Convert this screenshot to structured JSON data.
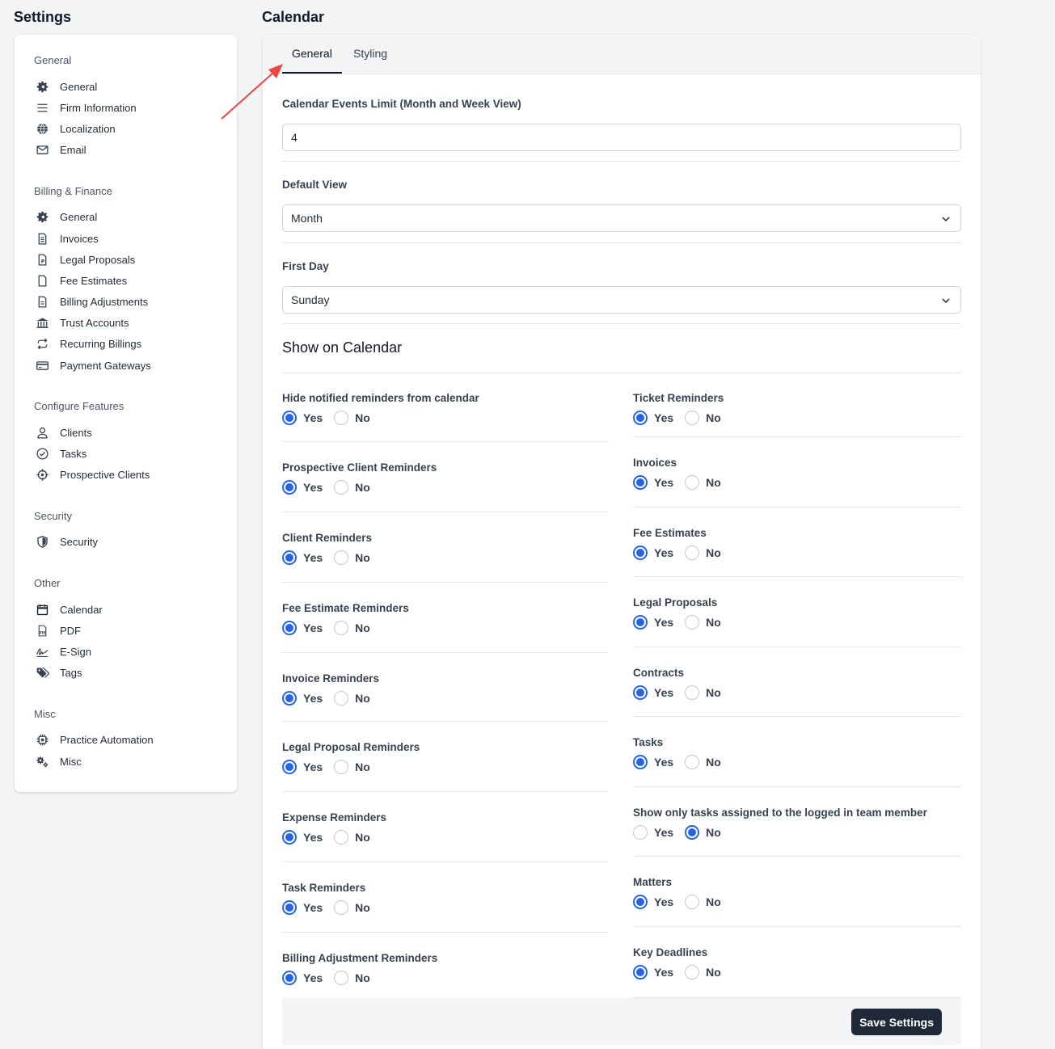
{
  "sidebar": {
    "title": "Settings",
    "groups": [
      {
        "title": "General",
        "items": [
          {
            "label": "General",
            "icon": "gear-icon"
          },
          {
            "label": "Firm Information",
            "icon": "lines-icon"
          },
          {
            "label": "Localization",
            "icon": "globe-icon"
          },
          {
            "label": "Email",
            "icon": "envelope-icon"
          }
        ]
      },
      {
        "title": "Billing & Finance",
        "items": [
          {
            "label": "General",
            "icon": "gear-icon"
          },
          {
            "label": "Invoices",
            "icon": "invoice-icon"
          },
          {
            "label": "Legal Proposals",
            "icon": "document-p-icon"
          },
          {
            "label": "Fee Estimates",
            "icon": "blank-document-icon"
          },
          {
            "label": "Billing Adjustments",
            "icon": "document-lines-icon"
          },
          {
            "label": "Trust Accounts",
            "icon": "bank-icon"
          },
          {
            "label": "Recurring Billings",
            "icon": "repeat-icon"
          },
          {
            "label": "Payment Gateways",
            "icon": "credit-card-icon"
          }
        ]
      },
      {
        "title": "Configure Features",
        "items": [
          {
            "label": "Clients",
            "icon": "user-icon"
          },
          {
            "label": "Tasks",
            "icon": "check-circle-icon"
          },
          {
            "label": "Prospective Clients",
            "icon": "crosshair-icon"
          }
        ]
      },
      {
        "title": "Security",
        "items": [
          {
            "label": "Security",
            "icon": "shield-icon"
          }
        ]
      },
      {
        "title": "Other",
        "items": [
          {
            "label": "Calendar",
            "icon": "calendar-icon"
          },
          {
            "label": "PDF",
            "icon": "pdf-icon"
          },
          {
            "label": "E-Sign",
            "icon": "signature-icon"
          },
          {
            "label": "Tags",
            "icon": "tags-icon"
          }
        ]
      },
      {
        "title": "Misc",
        "items": [
          {
            "label": "Practice Automation",
            "icon": "chip-icon"
          },
          {
            "label": "Misc",
            "icon": "gears-icon"
          }
        ]
      }
    ]
  },
  "main": {
    "title": "Calendar",
    "tabs": [
      {
        "label": "General",
        "active": true
      },
      {
        "label": "Styling",
        "active": false
      }
    ],
    "events_limit": {
      "label": "Calendar Events Limit (Month and Week View)",
      "value": "4"
    },
    "default_view": {
      "label": "Default View",
      "value": "Month"
    },
    "first_day": {
      "label": "First Day",
      "value": "Sunday"
    },
    "show_heading": "Show on Calendar",
    "yes_label": "Yes",
    "no_label": "No",
    "left_options": [
      {
        "label": "Hide notified reminders from calendar",
        "value": "Yes"
      },
      {
        "label": "Prospective Client Reminders",
        "value": "Yes"
      },
      {
        "label": "Client Reminders",
        "value": "Yes"
      },
      {
        "label": "Fee Estimate Reminders",
        "value": "Yes"
      },
      {
        "label": "Invoice Reminders",
        "value": "Yes"
      },
      {
        "label": "Legal Proposal Reminders",
        "value": "Yes"
      },
      {
        "label": "Expense Reminders",
        "value": "Yes"
      },
      {
        "label": "Task Reminders",
        "value": "Yes"
      },
      {
        "label": "Billing Adjustment Reminders",
        "value": "Yes"
      }
    ],
    "right_options": [
      {
        "label": "Ticket Reminders",
        "value": "Yes"
      },
      {
        "label": "Invoices",
        "value": "Yes"
      },
      {
        "label": "Fee Estimates",
        "value": "Yes"
      },
      {
        "label": "Legal Proposals",
        "value": "Yes"
      },
      {
        "label": "Contracts",
        "value": "Yes"
      },
      {
        "label": "Tasks",
        "value": "Yes"
      },
      {
        "label": "Show only tasks assigned to the logged in team member",
        "value": "No"
      },
      {
        "label": "Matters",
        "value": "Yes"
      },
      {
        "label": "Key Deadlines",
        "value": "Yes"
      }
    ],
    "save_label": "Save Settings"
  },
  "colors": {
    "accent": "#2563eb",
    "annotation_arrow": "#ef4444",
    "button": "#1f2937"
  }
}
